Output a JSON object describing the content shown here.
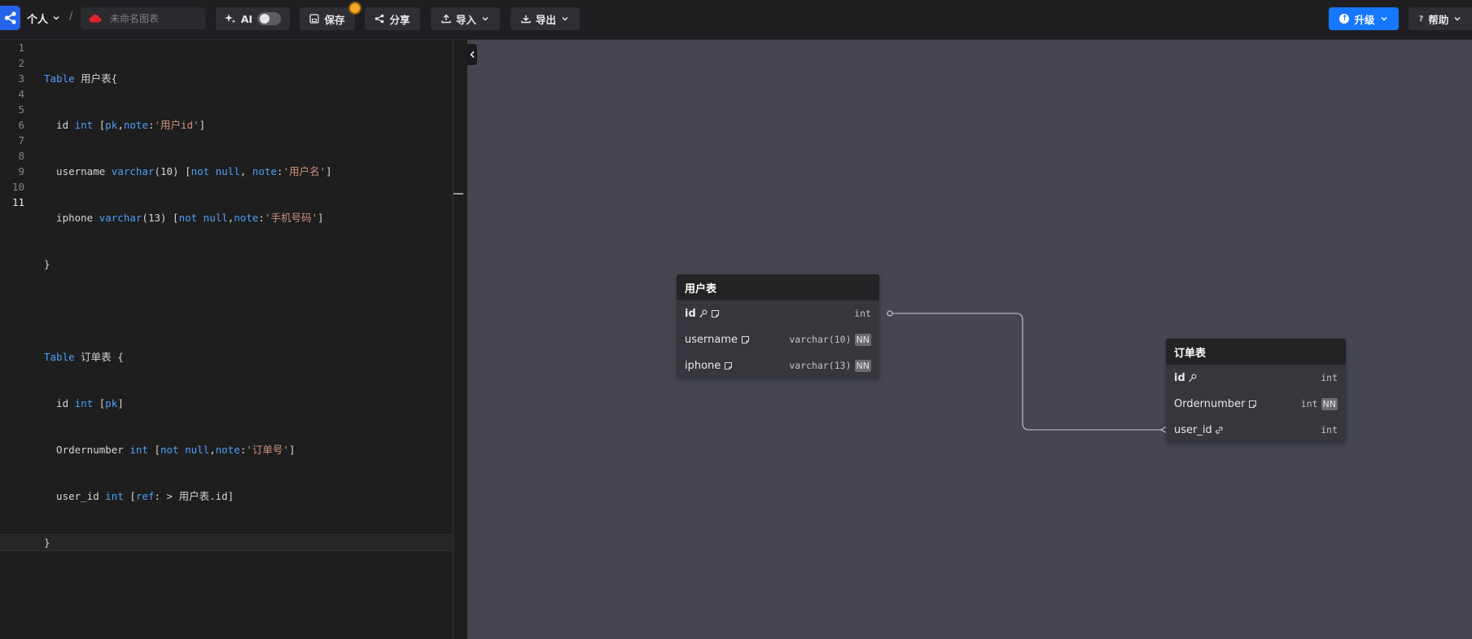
{
  "topbar": {
    "workspace": "个人",
    "separator": "/",
    "diagram_name_placeholder": "未命名图表",
    "ai_label": "AI",
    "save_label": "保存",
    "share_label": "分享",
    "import_label": "导入",
    "export_label": "导出",
    "upgrade_label": "升级",
    "help_label": "帮助",
    "help_glyph": "?"
  },
  "editor": {
    "line_numbers": [
      "1",
      "2",
      "3",
      "4",
      "5",
      "6",
      "7",
      "8",
      "9",
      "10",
      "11"
    ],
    "active_line": 11
  },
  "tables": [
    {
      "name": "用户表",
      "fields": [
        {
          "name": "id",
          "type": "int",
          "nn": false,
          "pk": true,
          "note": true,
          "ref": false
        },
        {
          "name": "username",
          "type": "varchar(10)",
          "nn": true,
          "pk": false,
          "note": true,
          "ref": false
        },
        {
          "name": "iphone",
          "type": "varchar(13)",
          "nn": true,
          "pk": false,
          "note": true,
          "ref": false
        }
      ]
    },
    {
      "name": "订单表",
      "fields": [
        {
          "name": "id",
          "type": "int",
          "nn": false,
          "pk": true,
          "note": false,
          "ref": false
        },
        {
          "name": "Ordernumber",
          "type": "int",
          "nn": true,
          "pk": false,
          "note": true,
          "ref": false
        },
        {
          "name": "user_id",
          "type": "int",
          "nn": false,
          "pk": false,
          "note": false,
          "ref": true
        }
      ]
    }
  ],
  "nn_badge": "NN",
  "code": {
    "l1_kw": "Table",
    "l1_name": " 用户表{",
    "l2_a": "  id ",
    "l2_ty": "int",
    "l2_b": " [",
    "l2_c": "pk",
    "l2_d": ",",
    "l2_e": "note",
    "l2_f": ":",
    "l2_str": "'用户id'",
    "l2_g": "]",
    "l3_a": "  username ",
    "l3_ty": "varchar",
    "l3_b": "(10) [",
    "l3_c": "not null",
    "l3_d": ", ",
    "l3_e": "note",
    "l3_f": ":",
    "l3_str": "'用户名'",
    "l3_g": "]",
    "l4_a": "  iphone ",
    "l4_ty": "varchar",
    "l4_b": "(13) [",
    "l4_c": "not null",
    "l4_d": ",",
    "l4_e": "note",
    "l4_f": ":",
    "l4_str": "'手机号码'",
    "l4_g": "]",
    "l5": "}",
    "l7_kw": "Table",
    "l7_name": " 订单表 {",
    "l8_a": "  id ",
    "l8_ty": "int",
    "l8_b": " [",
    "l8_c": "pk",
    "l8_g": "]",
    "l9_a": "  Ordernumber ",
    "l9_ty": "int",
    "l9_b": " [",
    "l9_c": "not null",
    "l9_d": ",",
    "l9_e": "note",
    "l9_f": ":",
    "l9_str": "'订单号'",
    "l9_g": "]",
    "l10_a": "  user_id ",
    "l10_ty": "int",
    "l10_b": " [",
    "l10_c": "ref",
    "l10_d": ": > 用户表.id]",
    "l11": "}"
  },
  "colors": {
    "accent": "#1677ff",
    "canvas": "#45464f",
    "keyword": "#4f9ff5",
    "string": "#ce9178",
    "badge": "#f5a623"
  }
}
